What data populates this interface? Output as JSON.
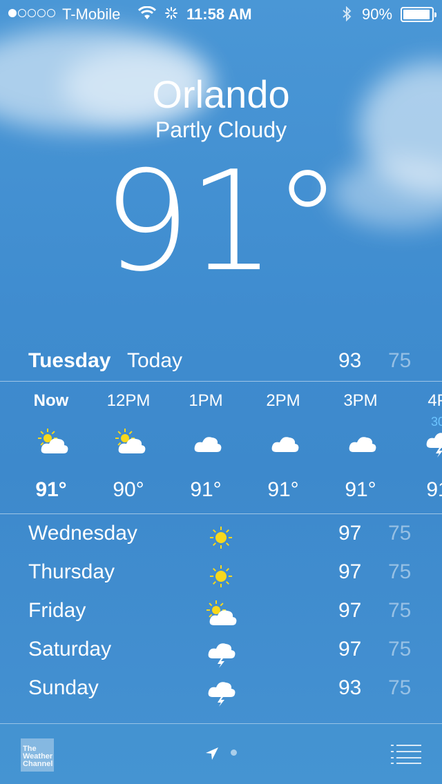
{
  "status_bar": {
    "carrier": "T-Mobile",
    "time": "11:58 AM",
    "battery": "90%",
    "signal_bars": 1,
    "signal_total": 5
  },
  "header": {
    "city": "Orlando",
    "condition": "Partly Cloudy",
    "temperature": "91°"
  },
  "today": {
    "day": "Tuesday",
    "label": "Today",
    "high": "93",
    "low": "75"
  },
  "hourly": [
    {
      "time": "Now",
      "icon": "partly-cloudy-icon",
      "temp": "91°",
      "pop": ""
    },
    {
      "time": "12PM",
      "icon": "partly-cloudy-icon",
      "temp": "90°",
      "pop": ""
    },
    {
      "time": "1PM",
      "icon": "cloud-icon",
      "temp": "91°",
      "pop": ""
    },
    {
      "time": "2PM",
      "icon": "cloud-icon",
      "temp": "91°",
      "pop": ""
    },
    {
      "time": "3PM",
      "icon": "cloud-icon",
      "temp": "91°",
      "pop": ""
    },
    {
      "time": "4P",
      "icon": "thunderstorm-icon",
      "temp": "91",
      "pop": "30"
    }
  ],
  "daily": [
    {
      "day": "Wednesday",
      "icon": "sun-icon",
      "high": "97",
      "low": "75"
    },
    {
      "day": "Thursday",
      "icon": "sun-icon",
      "high": "97",
      "low": "75"
    },
    {
      "day": "Friday",
      "icon": "partly-cloudy-icon",
      "high": "97",
      "low": "75"
    },
    {
      "day": "Saturday",
      "icon": "thunderstorm-icon",
      "high": "97",
      "low": "75"
    },
    {
      "day": "Sunday",
      "icon": "thunderstorm-icon",
      "high": "93",
      "low": "75"
    }
  ],
  "toolbar": {
    "logo_text": "The Weather Channel"
  },
  "colors": {
    "sky": "#4592d2",
    "sun": "#f8d81c",
    "low_temp": "#a9cbea",
    "pop": "#6cc4ff"
  }
}
